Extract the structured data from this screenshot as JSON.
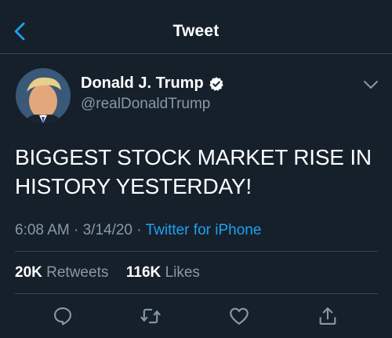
{
  "header": {
    "title": "Tweet",
    "back_icon": "chevron-left-icon"
  },
  "author": {
    "name": "Donald J. Trump",
    "handle": "@realDonaldTrump",
    "verified": true,
    "avatar_icon": "avatar"
  },
  "tweet": {
    "text": "BIGGEST STOCK MARKET RISE IN HISTORY YESTERDAY!",
    "time": "6:08 AM",
    "date": "3/14/20",
    "source": "Twitter for iPhone",
    "separator": "·"
  },
  "stats": {
    "retweets_count": "20K",
    "retweets_label": "Retweets",
    "likes_count": "116K",
    "likes_label": "Likes"
  },
  "actions": [
    "reply-icon",
    "retweet-icon",
    "like-icon",
    "share-icon"
  ],
  "colors": {
    "background": "#15202b",
    "accent": "#1da1f2",
    "secondary_text": "#8899a6",
    "divider": "#38444d"
  }
}
